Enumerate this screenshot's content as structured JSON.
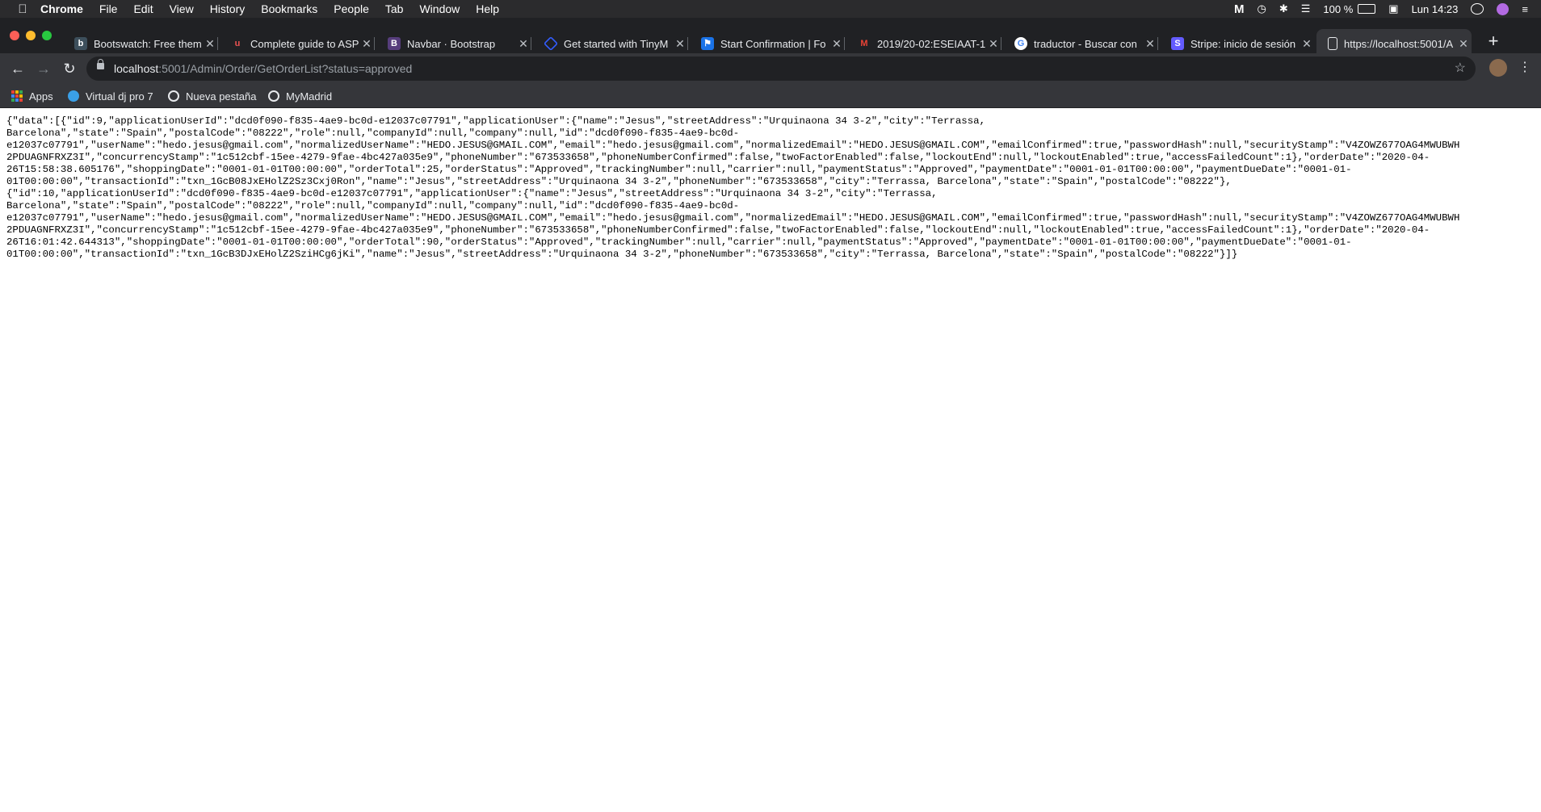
{
  "menubar": {
    "app": "Chrome",
    "items": [
      "File",
      "Edit",
      "View",
      "History",
      "Bookmarks",
      "People",
      "Tab",
      "Window",
      "Help"
    ],
    "battery": "100 %",
    "clock": "Lun 14:23"
  },
  "tabs": [
    {
      "title": "Bootswatch: Free them",
      "favicon": "bootswatch-icon",
      "color": "#3d4f5c"
    },
    {
      "title": "Complete guide to ASP",
      "favicon": "udemy-icon",
      "color": "#ec5252"
    },
    {
      "title": "Navbar · Bootstrap",
      "favicon": "bootstrap-icon",
      "color": "#563d7c"
    },
    {
      "title": "Get started with TinyM",
      "favicon": "tinymce-icon",
      "color": "#335dff"
    },
    {
      "title": "Start Confirmation | Fo",
      "favicon": "flag-icon",
      "color": "#1a73e8"
    },
    {
      "title": "2019/20-02:ESEIAAT-1",
      "favicon": "gmail-icon",
      "color": "#ea4335"
    },
    {
      "title": "traductor - Buscar con",
      "favicon": "google-icon",
      "color": "#4285f4"
    },
    {
      "title": "Stripe: inicio de sesión",
      "favicon": "stripe-icon",
      "color": "#635bff"
    },
    {
      "title": "https://localhost:5001/A",
      "favicon": "page-icon",
      "color": "#e8eaed"
    }
  ],
  "address": {
    "host": "localhost",
    "path": ":5001/Admin/Order/GetOrderList?status=approved"
  },
  "bookmarks": [
    "Apps",
    "Virtual dj pro 7",
    "Nueva pestaña",
    "MyMadrid"
  ],
  "body_text": "{\"data\":[{\"id\":9,\"applicationUserId\":\"dcd0f090-f835-4ae9-bc0d-e12037c07791\",\"applicationUser\":{\"name\":\"Jesus\",\"streetAddress\":\"Urquinaona 34 3-2\",\"city\":\"Terrassa,\nBarcelona\",\"state\":\"Spain\",\"postalCode\":\"08222\",\"role\":null,\"companyId\":null,\"company\":null,\"id\":\"dcd0f090-f835-4ae9-bc0d-\ne12037c07791\",\"userName\":\"hedo.jesus@gmail.com\",\"normalizedUserName\":\"HEDO.JESUS@GMAIL.COM\",\"email\":\"hedo.jesus@gmail.com\",\"normalizedEmail\":\"HEDO.JESUS@GMAIL.COM\",\"emailConfirmed\":true,\"passwordHash\":null,\"securityStamp\":\"V4ZOWZ677OAG4MWUBWH\n2PDUAGNFRXZ3I\",\"concurrencyStamp\":\"1c512cbf-15ee-4279-9fae-4bc427a035e9\",\"phoneNumber\":\"673533658\",\"phoneNumberConfirmed\":false,\"twoFactorEnabled\":false,\"lockoutEnd\":null,\"lockoutEnabled\":true,\"accessFailedCount\":1},\"orderDate\":\"2020-04-\n26T15:58:38.605176\",\"shoppingDate\":\"0001-01-01T00:00:00\",\"orderTotal\":25,\"orderStatus\":\"Approved\",\"trackingNumber\":null,\"carrier\":null,\"paymentStatus\":\"Approved\",\"paymentDate\":\"0001-01-01T00:00:00\",\"paymentDueDate\":\"0001-01-\n01T00:00:00\",\"transactionId\":\"txn_1GcB08JxEHolZ2Sz3Cxj0Ron\",\"name\":\"Jesus\",\"streetAddress\":\"Urquinaona 34 3-2\",\"phoneNumber\":\"673533658\",\"city\":\"Terrassa, Barcelona\",\"state\":\"Spain\",\"postalCode\":\"08222\"},\n{\"id\":10,\"applicationUserId\":\"dcd0f090-f835-4ae9-bc0d-e12037c07791\",\"applicationUser\":{\"name\":\"Jesus\",\"streetAddress\":\"Urquinaona 34 3-2\",\"city\":\"Terrassa,\nBarcelona\",\"state\":\"Spain\",\"postalCode\":\"08222\",\"role\":null,\"companyId\":null,\"company\":null,\"id\":\"dcd0f090-f835-4ae9-bc0d-\ne12037c07791\",\"userName\":\"hedo.jesus@gmail.com\",\"normalizedUserName\":\"HEDO.JESUS@GMAIL.COM\",\"email\":\"hedo.jesus@gmail.com\",\"normalizedEmail\":\"HEDO.JESUS@GMAIL.COM\",\"emailConfirmed\":true,\"passwordHash\":null,\"securityStamp\":\"V4ZOWZ677OAG4MWUBWH\n2PDUAGNFRXZ3I\",\"concurrencyStamp\":\"1c512cbf-15ee-4279-9fae-4bc427a035e9\",\"phoneNumber\":\"673533658\",\"phoneNumberConfirmed\":false,\"twoFactorEnabled\":false,\"lockoutEnd\":null,\"lockoutEnabled\":true,\"accessFailedCount\":1},\"orderDate\":\"2020-04-\n26T16:01:42.644313\",\"shoppingDate\":\"0001-01-01T00:00:00\",\"orderTotal\":90,\"orderStatus\":\"Approved\",\"trackingNumber\":null,\"carrier\":null,\"paymentStatus\":\"Approved\",\"paymentDate\":\"0001-01-01T00:00:00\",\"paymentDueDate\":\"0001-01-\n01T00:00:00\",\"transactionId\":\"txn_1GcB3DJxEHolZ2SziHCg6jKi\",\"name\":\"Jesus\",\"streetAddress\":\"Urquinaona 34 3-2\",\"phoneNumber\":\"673533658\",\"city\":\"Terrassa, Barcelona\",\"state\":\"Spain\",\"postalCode\":\"08222\"}]}"
}
